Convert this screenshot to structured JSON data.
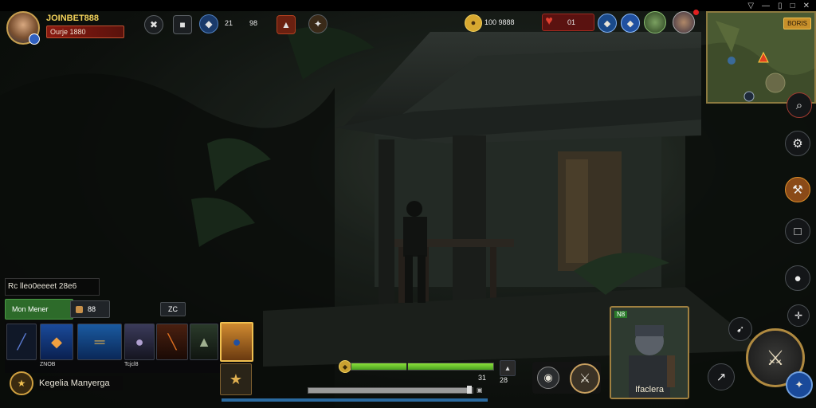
{
  "player": {
    "name": "JOINBET888",
    "rank_label": "Ourje 1880"
  },
  "top_hud": {
    "stat1": "21",
    "stat2": "98",
    "gold": "100 9888",
    "hearts": "01"
  },
  "minimap": {
    "label": "BORIS"
  },
  "left_panel": {
    "status_text": "Rc lleo0eeeet 28e6",
    "mode_button": "Mon Mener",
    "count_value": "88",
    "small_button": "ZC",
    "skill_labels": [
      "ZNOB",
      "Tcjcl8"
    ],
    "character_label": "Kegelia Manyerga"
  },
  "bottom": {
    "hp_value": "31",
    "right_value": "28"
  },
  "portrait": {
    "badge": "N8",
    "name": "Ifaclera"
  },
  "colors": {
    "gold": "#f2d25a",
    "hp_green": "#6ac830",
    "alert_red": "#8a1a10"
  }
}
